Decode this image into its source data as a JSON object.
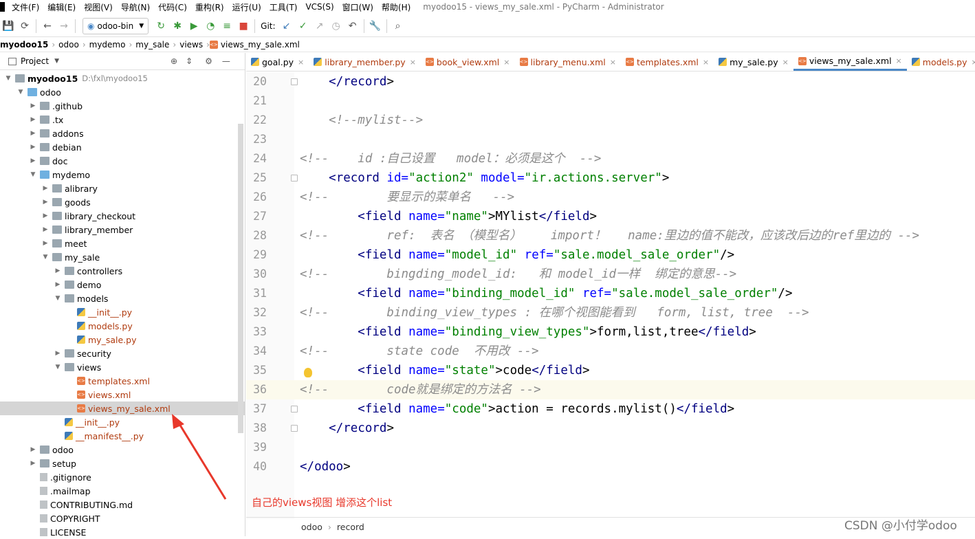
{
  "menubar": {
    "items": [
      "文件(F)",
      "编辑(E)",
      "视图(V)",
      "导航(N)",
      "代码(C)",
      "重构(R)",
      "运行(U)",
      "工具(T)",
      "VCS(S)",
      "窗口(W)",
      "帮助(H)"
    ],
    "title": "myodoo15 - views_my_sale.xml - PyCharm - Administrator"
  },
  "toolbar": {
    "run_config": "odoo-bin",
    "git_label": "Git:"
  },
  "breadcrumbs": [
    "myodoo15",
    "odoo",
    "mydemo",
    "my_sale",
    "views",
    "views_my_sale.xml"
  ],
  "project_panel": {
    "title": "Project",
    "tree": [
      {
        "label": "myodoo15",
        "path": "D:\\fxl\\myodoo15",
        "depth": 0,
        "type": "folder",
        "open": true,
        "bold": true
      },
      {
        "label": "odoo",
        "depth": 1,
        "type": "folder-blue",
        "open": true
      },
      {
        "label": ".github",
        "depth": 2,
        "type": "folder",
        "open": false
      },
      {
        "label": ".tx",
        "depth": 2,
        "type": "folder",
        "open": false
      },
      {
        "label": "addons",
        "depth": 2,
        "type": "folder",
        "open": false
      },
      {
        "label": "debian",
        "depth": 2,
        "type": "folder",
        "open": false
      },
      {
        "label": "doc",
        "depth": 2,
        "type": "folder",
        "open": false
      },
      {
        "label": "mydemo",
        "depth": 2,
        "type": "folder-blue",
        "open": true
      },
      {
        "label": "alibrary",
        "depth": 3,
        "type": "folder",
        "open": false
      },
      {
        "label": "goods",
        "depth": 3,
        "type": "folder",
        "open": false
      },
      {
        "label": "library_checkout",
        "depth": 3,
        "type": "folder",
        "open": false
      },
      {
        "label": "library_member",
        "depth": 3,
        "type": "folder",
        "open": false
      },
      {
        "label": "meet",
        "depth": 3,
        "type": "folder",
        "open": false
      },
      {
        "label": "my_sale",
        "depth": 3,
        "type": "folder",
        "open": true
      },
      {
        "label": "controllers",
        "depth": 4,
        "type": "folder",
        "open": false
      },
      {
        "label": "demo",
        "depth": 4,
        "type": "folder",
        "open": false
      },
      {
        "label": "models",
        "depth": 4,
        "type": "folder",
        "open": true
      },
      {
        "label": "__init__.py",
        "depth": 5,
        "type": "py",
        "red": true
      },
      {
        "label": "models.py",
        "depth": 5,
        "type": "py",
        "red": true
      },
      {
        "label": "my_sale.py",
        "depth": 5,
        "type": "py",
        "red": true
      },
      {
        "label": "security",
        "depth": 4,
        "type": "folder",
        "open": false
      },
      {
        "label": "views",
        "depth": 4,
        "type": "folder",
        "open": true
      },
      {
        "label": "templates.xml",
        "depth": 5,
        "type": "xml",
        "red": true
      },
      {
        "label": "views.xml",
        "depth": 5,
        "type": "xml",
        "red": true
      },
      {
        "label": "views_my_sale.xml",
        "depth": 5,
        "type": "xml",
        "red": true,
        "selected": true
      },
      {
        "label": "__init__.py",
        "depth": 4,
        "type": "py",
        "red": true
      },
      {
        "label": "__manifest__.py",
        "depth": 4,
        "type": "py",
        "red": true
      },
      {
        "label": "odoo",
        "depth": 2,
        "type": "folder",
        "open": false
      },
      {
        "label": "setup",
        "depth": 2,
        "type": "folder",
        "open": false
      },
      {
        "label": ".gitignore",
        "depth": 2,
        "type": "txt"
      },
      {
        "label": ".mailmap",
        "depth": 2,
        "type": "txt"
      },
      {
        "label": "CONTRIBUTING.md",
        "depth": 2,
        "type": "txt"
      },
      {
        "label": "COPYRIGHT",
        "depth": 2,
        "type": "txt"
      },
      {
        "label": "LICENSE",
        "depth": 2,
        "type": "txt"
      }
    ]
  },
  "tabs": [
    {
      "label": "goal.py",
      "type": "py",
      "active": false
    },
    {
      "label": "library_member.py",
      "type": "py",
      "active": false
    },
    {
      "label": "book_view.xml",
      "type": "xml",
      "active": false
    },
    {
      "label": "library_menu.xml",
      "type": "xml",
      "active": false
    },
    {
      "label": "templates.xml",
      "type": "xml",
      "active": false
    },
    {
      "label": "my_sale.py",
      "type": "py",
      "active": false
    },
    {
      "label": "views_my_sale.xml",
      "type": "xml",
      "active": true
    },
    {
      "label": "models.py",
      "type": "py",
      "active": false
    }
  ],
  "code_lines": [
    {
      "n": "20",
      "segs": [
        [
          "p",
          "    "
        ],
        [
          "tag",
          "</record"
        ],
        [
          "p",
          ">"
        ]
      ]
    },
    {
      "n": "21",
      "segs": []
    },
    {
      "n": "22",
      "segs": [
        [
          "p",
          "    "
        ],
        [
          "cm",
          "<!--mylist-->"
        ]
      ]
    },
    {
      "n": "23",
      "segs": []
    },
    {
      "n": "24",
      "segs": [
        [
          "cm",
          "<!--    id :自己设置   model：必须是这个  -->"
        ]
      ]
    },
    {
      "n": "25",
      "segs": [
        [
          "p",
          "    "
        ],
        [
          "tag",
          "<record "
        ],
        [
          "attr",
          "id="
        ],
        [
          "val",
          "\"action2\" "
        ],
        [
          "attr",
          "model="
        ],
        [
          "val",
          "\"ir.actions.server\""
        ],
        [
          "p",
          ">"
        ]
      ]
    },
    {
      "n": "26",
      "segs": [
        [
          "cm",
          "<!--        要显示的菜单名   -->"
        ]
      ]
    },
    {
      "n": "27",
      "segs": [
        [
          "p",
          "        "
        ],
        [
          "tag",
          "<field "
        ],
        [
          "attr",
          "name="
        ],
        [
          "val",
          "\"name\""
        ],
        [
          "p",
          ">MYlist"
        ],
        [
          "tag",
          "</field"
        ],
        [
          "p",
          ">"
        ]
      ]
    },
    {
      "n": "28",
      "segs": [
        [
          "cm",
          "<!--        ref:  表名 （模型名）    import！   name:里边的值不能改，应该改后边的ref里边的 -->"
        ]
      ]
    },
    {
      "n": "29",
      "segs": [
        [
          "p",
          "        "
        ],
        [
          "tag",
          "<field "
        ],
        [
          "attr",
          "name="
        ],
        [
          "val",
          "\"model_id\" "
        ],
        [
          "attr",
          "ref="
        ],
        [
          "val",
          "\"sale.model_sale_order\""
        ],
        [
          "p",
          "/>"
        ]
      ]
    },
    {
      "n": "30",
      "segs": [
        [
          "cm",
          "<!--        bingding_model_id:   和 model_id一样  绑定的意思-->"
        ]
      ]
    },
    {
      "n": "31",
      "segs": [
        [
          "p",
          "        "
        ],
        [
          "tag",
          "<field "
        ],
        [
          "attr",
          "name="
        ],
        [
          "val",
          "\"binding_model_id\" "
        ],
        [
          "attr",
          "ref="
        ],
        [
          "val",
          "\"sale.model_sale_order\""
        ],
        [
          "p",
          "/>"
        ]
      ]
    },
    {
      "n": "32",
      "segs": [
        [
          "cm",
          "<!--        binding_view_types : 在哪个视图能看到   form, list, tree  -->"
        ]
      ]
    },
    {
      "n": "33",
      "segs": [
        [
          "p",
          "        "
        ],
        [
          "tag",
          "<field "
        ],
        [
          "attr",
          "name="
        ],
        [
          "val",
          "\"binding_view_types\""
        ],
        [
          "p",
          ">form,list,tree"
        ],
        [
          "tag",
          "</field"
        ],
        [
          "p",
          ">"
        ]
      ]
    },
    {
      "n": "34",
      "segs": [
        [
          "cm",
          "<!--        state code  不用改 -->"
        ]
      ]
    },
    {
      "n": "35",
      "segs": [
        [
          "p",
          "        "
        ],
        [
          "tag",
          "<field "
        ],
        [
          "attr",
          "name="
        ],
        [
          "val",
          "\"state\""
        ],
        [
          "p",
          ">code"
        ],
        [
          "tag",
          "</field"
        ],
        [
          "p",
          ">"
        ]
      ]
    },
    {
      "n": "36",
      "segs": [
        [
          "cm",
          "<!--        code就是绑定的方法名 -->"
        ]
      ],
      "current": true
    },
    {
      "n": "37",
      "segs": [
        [
          "p",
          "        "
        ],
        [
          "tag",
          "<field "
        ],
        [
          "attr",
          "name="
        ],
        [
          "val",
          "\"code\""
        ],
        [
          "p",
          ">action = records.mylist()"
        ],
        [
          "tag",
          "</field"
        ],
        [
          "p",
          ">"
        ]
      ]
    },
    {
      "n": "38",
      "segs": [
        [
          "p",
          "    "
        ],
        [
          "tag",
          "</record"
        ],
        [
          "p",
          ">"
        ]
      ]
    },
    {
      "n": "39",
      "segs": []
    },
    {
      "n": "40",
      "segs": [
        [
          "tag",
          "</odoo"
        ],
        [
          "p",
          ">"
        ]
      ]
    }
  ],
  "annotation": "自己的views视图  增添这个list",
  "statusbar": [
    "odoo",
    "record"
  ],
  "watermark": "CSDN @小付学odoo",
  "colors": {
    "accent": "#4a88c7",
    "annotation": "#e8382b",
    "tag": "#000080",
    "attr": "#0000ff",
    "value": "#008000",
    "comment": "#8c8c8c"
  }
}
